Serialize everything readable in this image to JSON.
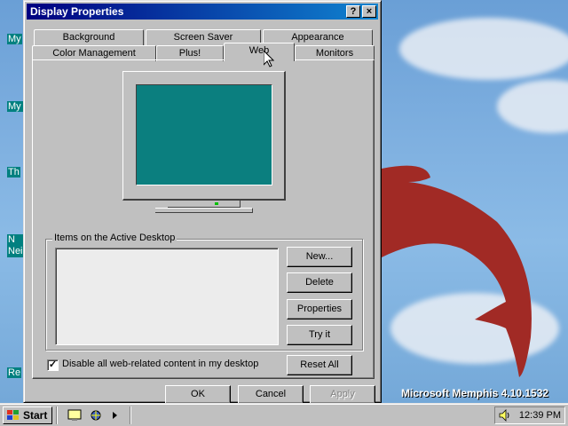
{
  "desktop": {
    "icons": [
      "My",
      "My D",
      "Th",
      "N\nNeig",
      "Re"
    ],
    "watermark": "Microsoft Memphis 4.10.1532"
  },
  "dialog": {
    "title": "Display Properties",
    "help_button": "?",
    "close_button": "×",
    "tabs_row1": [
      "Background",
      "Screen Saver",
      "Appearance"
    ],
    "tabs_row2": [
      "Color Management",
      "Plus!",
      "Web",
      "Monitors"
    ],
    "active_tab": "Web",
    "groupbox_label": "Items on the Active Desktop",
    "items": [],
    "buttons": {
      "new": "New...",
      "delete": "Delete",
      "properties": "Properties",
      "try_it": "Try it",
      "reset_all": "Reset All"
    },
    "checkbox": {
      "label": "Disable all web-related content in my desktop",
      "checked": true
    },
    "footer": {
      "ok": "OK",
      "cancel": "Cancel",
      "apply": "Apply"
    }
  },
  "taskbar": {
    "start_label": "Start",
    "clock": "12:39 PM"
  },
  "colors": {
    "title_active": "#000080",
    "preview_screen": "#0b7f7f",
    "face": "#c0c0c0"
  }
}
